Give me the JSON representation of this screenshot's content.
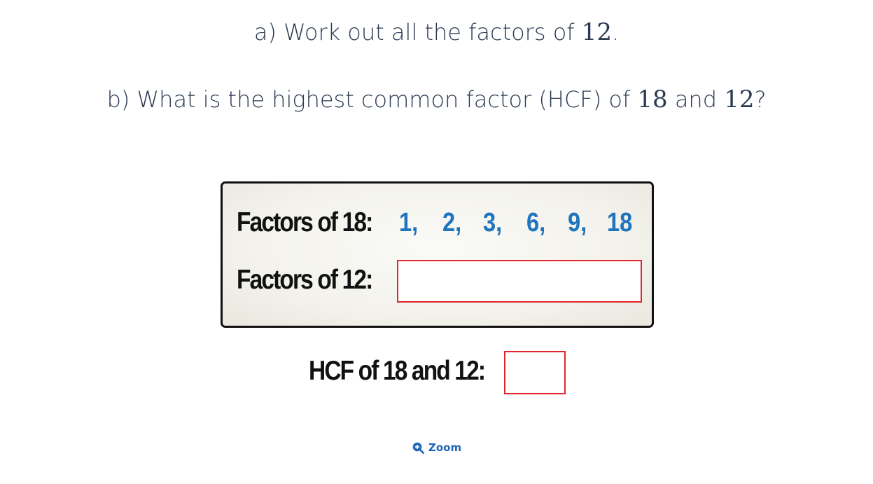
{
  "questions": {
    "a": {
      "pre": "a) Work out all the factors of ",
      "n1": "12",
      "post": "."
    },
    "b": {
      "pre": "b) What is the highest common factor (HCF) of ",
      "n1": "18",
      "mid": " and ",
      "n2": "12",
      "post": "?"
    }
  },
  "card": {
    "factors18_label": "Factors of 18:",
    "factors18": [
      "1,",
      "2,",
      "3,",
      "6,",
      "9,",
      "18"
    ],
    "factors12_label": "Factors of 12:",
    "factors12_value": ""
  },
  "hcf": {
    "label": "HCF of 18 and 12:",
    "value": ""
  },
  "zoom": {
    "label": "Zoom",
    "icon": "zoom-in-icon"
  },
  "colors": {
    "factor_blue": "#1f74bd",
    "answer_border_red": "#e1262c",
    "link_blue": "#1f66b8"
  }
}
